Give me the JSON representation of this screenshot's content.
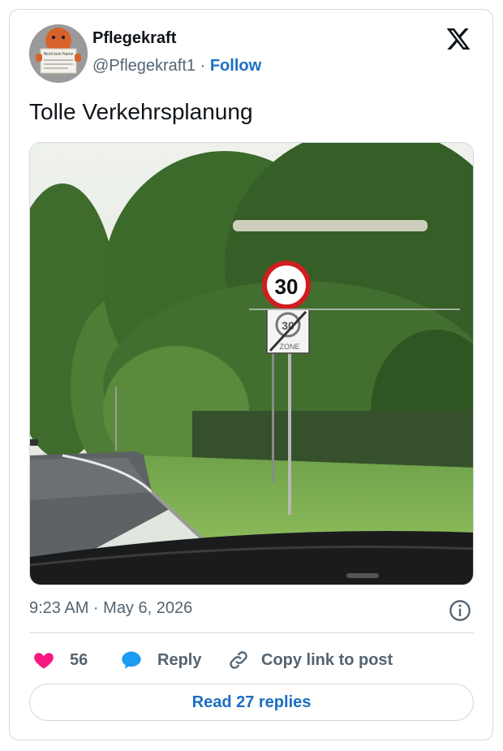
{
  "author": {
    "name": "Pflegekraft",
    "handle": "@Pflegekraft1",
    "separator": "·",
    "follow_label": "Follow",
    "avatar_sign_text": "Nicht kein Name"
  },
  "platform_logo": "x-logo-icon",
  "tweet": {
    "text": "Tolle Verkehrsplanung",
    "timestamp": "9:23 AM · May 6, 2026"
  },
  "photo": {
    "sign_speed_limit": "30",
    "sign_end_zone_number": "30",
    "sign_end_zone_text": "ZONE"
  },
  "actions": {
    "like_count": "56",
    "reply_label": "Reply",
    "copy_label": "Copy link to post"
  },
  "read_replies_label": "Read 27 replies",
  "colors": {
    "accent": "#1d6fc2",
    "heart": "#f91880",
    "reply_bubble": "#1d9bf0",
    "muted": "#536471",
    "border": "#cfd9de"
  }
}
